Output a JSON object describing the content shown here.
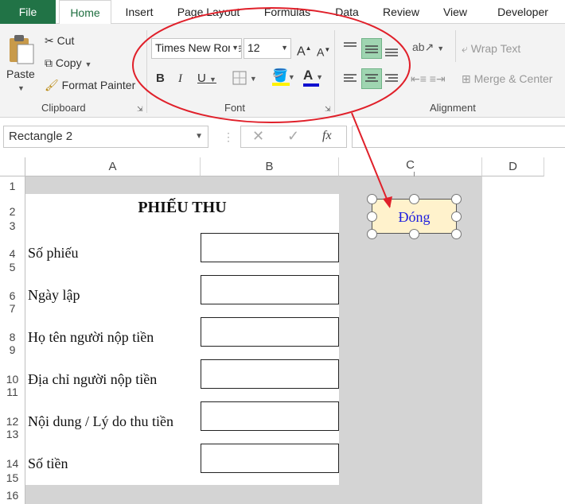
{
  "tabs": [
    "File",
    "Home",
    "Insert",
    "Page Layout",
    "Formulas",
    "Data",
    "Review",
    "View",
    "Developer"
  ],
  "clipboard": {
    "paste": "Paste",
    "cut": "Cut",
    "copy": "Copy",
    "format_painter": "Format Painter",
    "group": "Clipboard"
  },
  "font": {
    "name": "Times New Roman",
    "size": "12",
    "bold": "B",
    "italic": "I",
    "underline": "U",
    "font_color_letter": "A",
    "grow": "A",
    "shrink": "A",
    "group": "Font"
  },
  "alignment": {
    "wrap_text": "Wrap Text",
    "merge_center": "Merge & Center",
    "group": "Alignment"
  },
  "formula_bar": {
    "name_box": "Rectangle 2",
    "fx": "fx"
  },
  "columns": [
    "A",
    "B",
    "C",
    "D"
  ],
  "rows": [
    "1",
    "2",
    "3",
    "4",
    "5",
    "6",
    "7",
    "8",
    "9",
    "10",
    "11",
    "12",
    "13",
    "14",
    "15",
    "16"
  ],
  "sheet": {
    "title": "PHIẾU THU",
    "fields": [
      "Số phiếu",
      "Ngày lập",
      "Họ tên người nộp tiền",
      "Địa chỉ người nộp tiền",
      "Nội dung / Lý do thu tiền",
      "Số tiền"
    ],
    "button": "Đóng"
  },
  "colors": {
    "file_tab": "#217346",
    "annotation": "#e0202a",
    "shape_fill": "#fff2cc",
    "shape_text": "#1c1ce0"
  }
}
